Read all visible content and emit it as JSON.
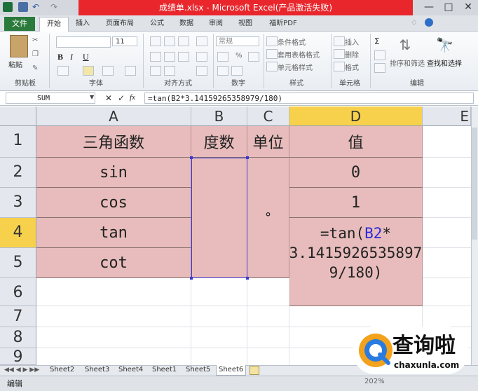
{
  "window": {
    "title": "成绩单.xlsx - Microsoft Excel(产品激活失败)",
    "controls": [
      "—",
      "□",
      "✕"
    ]
  },
  "ribbon": {
    "tabs": [
      "文件",
      "开始",
      "插入",
      "页面布局",
      "公式",
      "数据",
      "审阅",
      "视图",
      "福昕PDF"
    ],
    "clipboard": {
      "paste_label": "粘贴",
      "group": "剪贴板"
    },
    "font": {
      "size": "11",
      "bold": "B",
      "italic": "I",
      "underline": "U",
      "group": "字体"
    },
    "alignment": {
      "group": "对齐方式"
    },
    "number": {
      "format": "常规",
      "percent": "%",
      "group": "数字"
    },
    "styles": {
      "cond": "条件格式",
      "table": "套用表格格式",
      "cell": "单元格样式",
      "group": "样式"
    },
    "cells": {
      "insert": "插入",
      "delete": "删除",
      "format": "格式",
      "group": "单元格"
    },
    "editing": {
      "sort": "排序和筛选",
      "find": "查找和选择",
      "group": "编辑"
    }
  },
  "formula_bar": {
    "name_box": "SUM",
    "formula": "=tan(B2*3.14159265358979/180)",
    "fx": "fx",
    "cancel": "✕",
    "enter": "✓"
  },
  "columns": [
    "A",
    "B",
    "C",
    "D",
    "E"
  ],
  "rows": [
    "1",
    "2",
    "3",
    "4",
    "5",
    "6",
    "7",
    "8",
    "9"
  ],
  "cells": {
    "A1": "三角函数",
    "B1": "度数",
    "C1": "单位",
    "D1": "值",
    "A2": "sin",
    "A3": "cos",
    "A4": "tan",
    "A5": "cot",
    "C_unit": "°",
    "D2": "0",
    "D3": "1",
    "D4_line1_pre": "=tan(",
    "D4_ref": "B2",
    "D4_line1_post": "*",
    "D4_line2": "3.1415926535897",
    "D4_line3": "9/180)"
  },
  "sheets": [
    "Sheet2",
    "Sheet3",
    "Sheet4",
    "Sheet1",
    "Sheet5",
    "Sheet6"
  ],
  "active_sheet": "Sheet6",
  "status": {
    "mode": "编辑",
    "zoom": "202%"
  },
  "watermark": {
    "text": "查询啦",
    "url": "chaxunla.com"
  },
  "colors": {
    "title_red": "#e8262c",
    "cell_fill": "#e8bcbc",
    "selected_header": "#f7d14c",
    "ref_blue": "#2a2ad8"
  }
}
